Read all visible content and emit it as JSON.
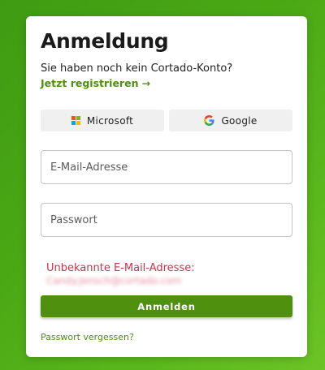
{
  "login": {
    "title": "Anmeldung",
    "no_account_text": "Sie haben noch kein Cortado-Konto?",
    "register_label": "Jetzt registrieren",
    "register_arrow": "→",
    "sso": {
      "microsoft_label": "Microsoft",
      "google_label": "Google"
    },
    "email_placeholder": "E-Mail-Adresse",
    "password_placeholder": "Passwort",
    "error_title": "Unbekannte E-Mail-Adresse:",
    "error_detail": "Candy.Jensch@cortado.com",
    "submit_label": "Anmelden",
    "forgot_label": "Passwort vergessen?"
  },
  "colors": {
    "accent": "#4f900e",
    "error": "#c8334f",
    "background": "#4aa815"
  },
  "icons": {
    "microsoft": "microsoft-logo-icon",
    "google": "google-logo-icon",
    "arrow": "arrow-right-icon"
  }
}
